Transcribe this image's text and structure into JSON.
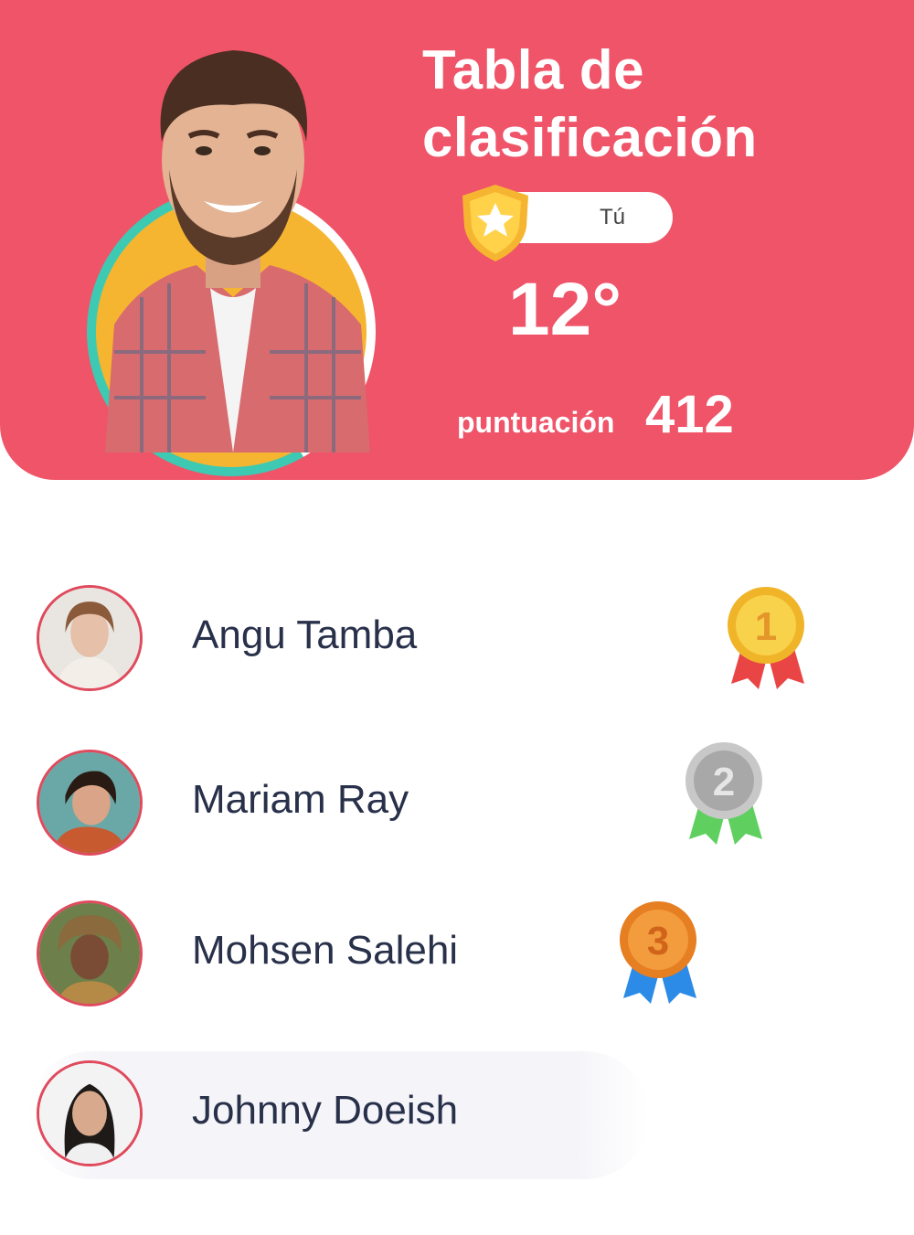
{
  "header": {
    "title_line1": "Tabla de",
    "title_line2": "clasificación",
    "you_label": "Tú",
    "rank": "12°",
    "score_label": "puntuación",
    "score_value": "412"
  },
  "colors": {
    "header_bg": "#ef5468",
    "ring_teal": "#3ec9b3",
    "avatar_bg": "#f6b530",
    "name_text": "#28304a",
    "gold": "#f4c430",
    "silver": "#a8a8a8",
    "bronze": "#e67e22"
  },
  "leaderboard": [
    {
      "name": "Angu Tamba",
      "medal": "1",
      "medal_type": "gold"
    },
    {
      "name": "Mariam Ray",
      "medal": "2",
      "medal_type": "silver"
    },
    {
      "name": "Mohsen Salehi",
      "medal": "3",
      "medal_type": "bronze"
    },
    {
      "name": "Johnny Doeish",
      "medal": null,
      "medal_type": null
    }
  ]
}
